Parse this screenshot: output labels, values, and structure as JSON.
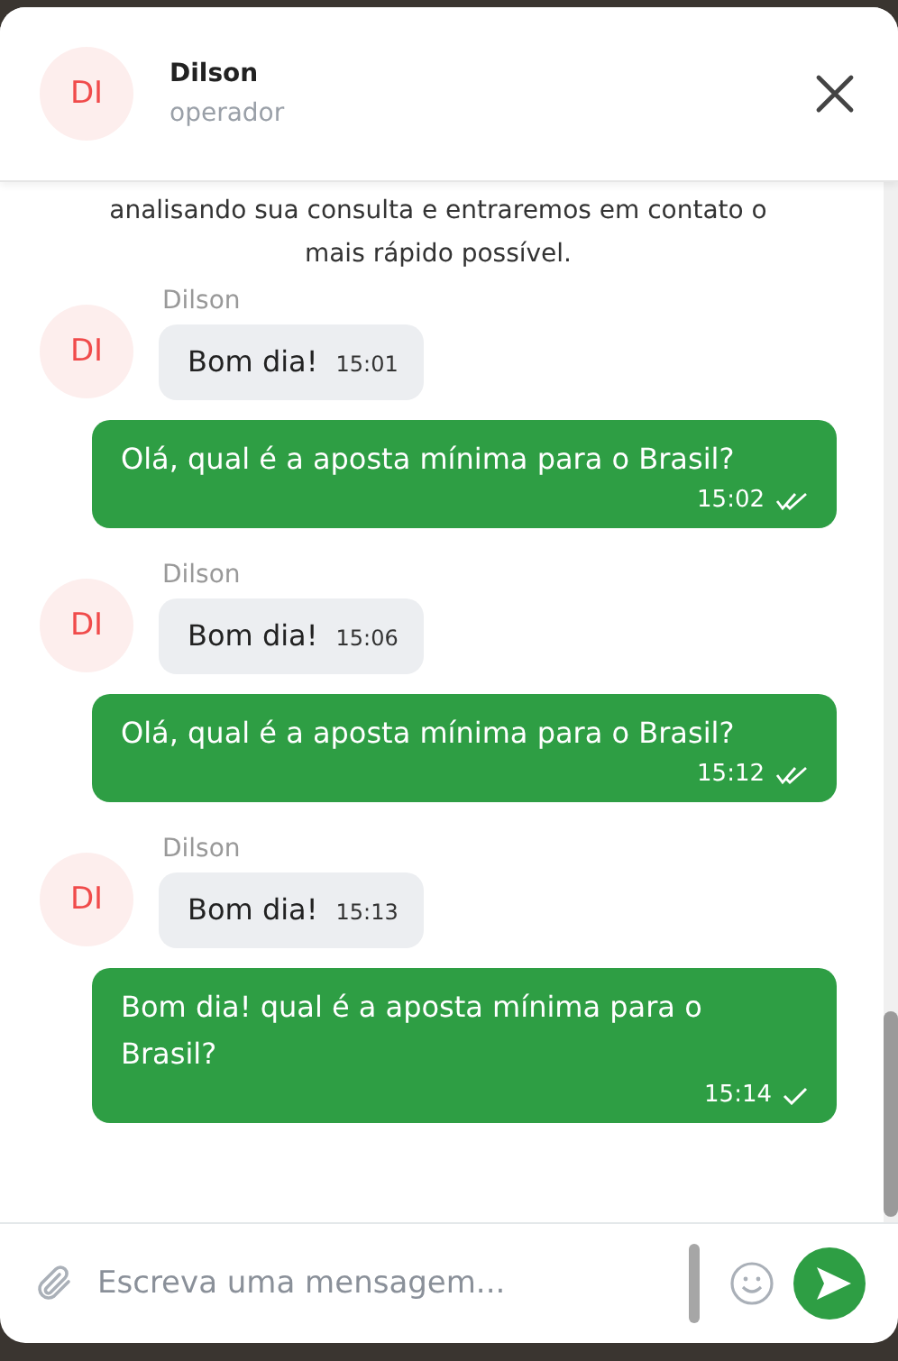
{
  "header": {
    "initials": "DI",
    "name": "Dilson",
    "role": "operador"
  },
  "intro": "analisando sua consulta e entraremos em contato o mais rápido possível.",
  "messages": [
    {
      "kind": "incoming",
      "sender": "Dilson",
      "initials": "DI",
      "text": "Bom dia!",
      "time": "15:01"
    },
    {
      "kind": "outgoing",
      "text": "Olá, qual é a aposta mínima para o Brasil?",
      "time": "15:02",
      "read": true
    },
    {
      "kind": "incoming",
      "sender": "Dilson",
      "initials": "DI",
      "text": "Bom dia!",
      "time": "15:06"
    },
    {
      "kind": "outgoing",
      "text": "Olá, qual é a aposta mínima para o Brasil?",
      "time": "15:12",
      "read": true
    },
    {
      "kind": "incoming",
      "sender": "Dilson",
      "initials": "DI",
      "text": "Bom dia!",
      "time": "15:13"
    },
    {
      "kind": "outgoing",
      "text": "Bom dia! qual é a aposta mínima para o Brasil?",
      "time": "15:14",
      "read": false
    }
  ],
  "composer": {
    "placeholder": "Escreva uma mensagem..."
  }
}
